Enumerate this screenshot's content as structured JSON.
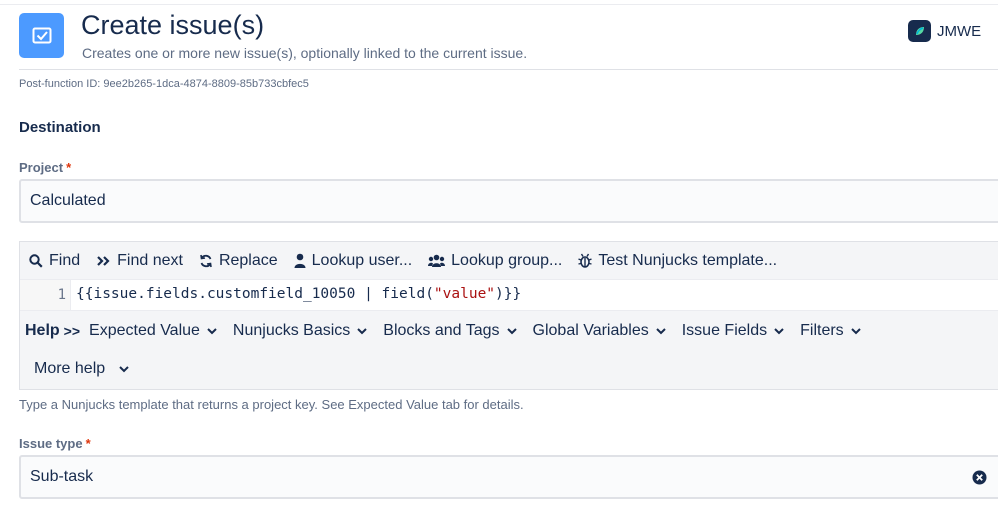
{
  "header": {
    "title": "Create issue(s)",
    "subtitle": "Creates one or more new issue(s), optionally linked to the current issue.",
    "brand": "JMWE"
  },
  "post_function_id": "Post-function ID: 9ee2b265-1dca-4874-8809-85b733cbfec5",
  "destination": {
    "title": "Destination",
    "project": {
      "label": "Project",
      "required": "*",
      "value": "Calculated"
    },
    "editor": {
      "toolbar": {
        "find": "Find",
        "find_next": "Find next",
        "replace": "Replace",
        "lookup_user": "Lookup user...",
        "lookup_group": "Lookup group...",
        "test_template": "Test Nunjucks template..."
      },
      "line_number": "1",
      "code_before": "{{issue.fields.customfield_10050 | field(",
      "code_string": "\"value\"",
      "code_after": ")}}",
      "help": {
        "label": "Help",
        "arrows": ">>",
        "tabs": [
          "Expected Value",
          "Nunjucks Basics",
          "Blocks and Tags",
          "Global Variables",
          "Issue Fields",
          "Filters"
        ],
        "more": "More help"
      }
    },
    "hint": "Type a Nunjucks template that returns a project key. See Expected Value tab for details.",
    "issue_type": {
      "label": "Issue type",
      "required": "*",
      "value": "Sub-task"
    }
  },
  "colors": {
    "accent": "#4c9aff",
    "required": "#de350b",
    "string_literal": "#aa1111"
  },
  "icons": [
    "checkbox-icon",
    "jmwe-logo-icon",
    "search-icon",
    "find-next-icon",
    "replace-icon",
    "user-icon",
    "group-icon",
    "bug-icon",
    "chevron-down-icon",
    "clear-icon"
  ]
}
